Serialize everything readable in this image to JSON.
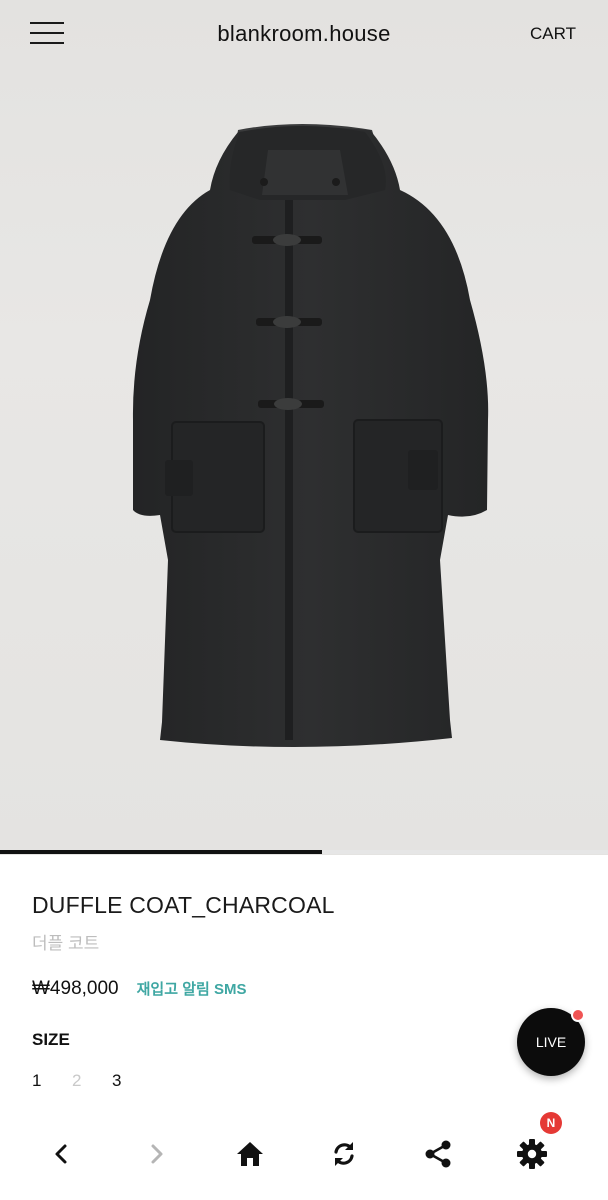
{
  "header": {
    "brand": "blankroom.house",
    "cart_label": "CART"
  },
  "gallery": {
    "image_alt": "charcoal duffle coat on hanger",
    "progress": 0.53
  },
  "product": {
    "name": "DUFFLE COAT_CHARCOAL",
    "name_ko": "더플 코트",
    "price": "₩498,000",
    "restock_alert": "재입고 알림 SMS",
    "size_label": "SIZE",
    "sizes": [
      {
        "label": "1",
        "available": true
      },
      {
        "label": "2",
        "available": false
      },
      {
        "label": "3",
        "available": true
      }
    ]
  },
  "live_button": {
    "label": "LIVE"
  },
  "toolbar": {
    "icons": [
      "chevron-left-icon",
      "chevron-right-icon",
      "home-icon",
      "refresh-icon",
      "share-icon",
      "gear-icon"
    ],
    "settings_badge": "N"
  },
  "colors": {
    "accent": "#3fa7a3",
    "badge": "#e53935",
    "coat": "#2b2c2d"
  }
}
